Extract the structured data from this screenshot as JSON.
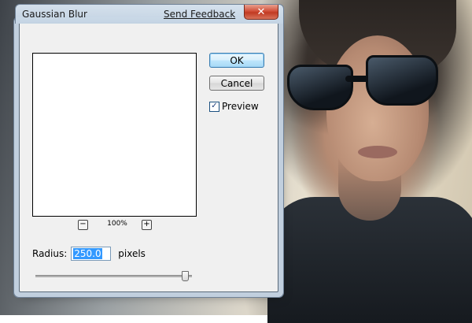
{
  "dialog": {
    "title": "Gaussian Blur",
    "feedback_link": "Send Feedback",
    "close_symbol": "✕"
  },
  "buttons": {
    "ok": "OK",
    "cancel": "Cancel"
  },
  "preview": {
    "checkbox_label": "Preview",
    "checked": true,
    "check_mark": "✓"
  },
  "zoom": {
    "minus": "−",
    "plus": "+",
    "level": "100%"
  },
  "radius": {
    "label": "Radius:",
    "value": "250.0",
    "unit": "pixels",
    "slider_fraction": 1.0
  },
  "icons": {
    "close": "close-icon",
    "check": "check-icon",
    "zoom_out": "minus-icon",
    "zoom_in": "plus-icon"
  }
}
